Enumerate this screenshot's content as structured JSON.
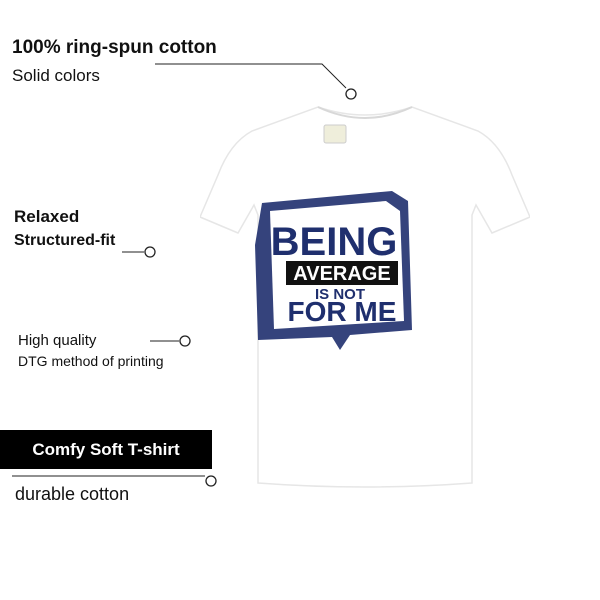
{
  "features": {
    "fabric": {
      "title": "100% ring-spun cotton",
      "subtitle": "Solid colors"
    },
    "fit": {
      "title": "Relaxed",
      "subtitle": "Structured-fit"
    },
    "print": {
      "title": "High quality",
      "subtitle": "DTG method of printing"
    },
    "comfort": {
      "badge": "Comfy Soft T-shirt",
      "subtitle": "durable cotton"
    }
  },
  "design": {
    "line1": "BEING",
    "line2": "AVERAGE",
    "line3": "IS NOT",
    "line4": "FOR ME",
    "ink_color": "#1f2f6e"
  },
  "colors": {
    "shirt": "#ffffff",
    "badge_bg": "#000000",
    "badge_text": "#ffffff"
  }
}
